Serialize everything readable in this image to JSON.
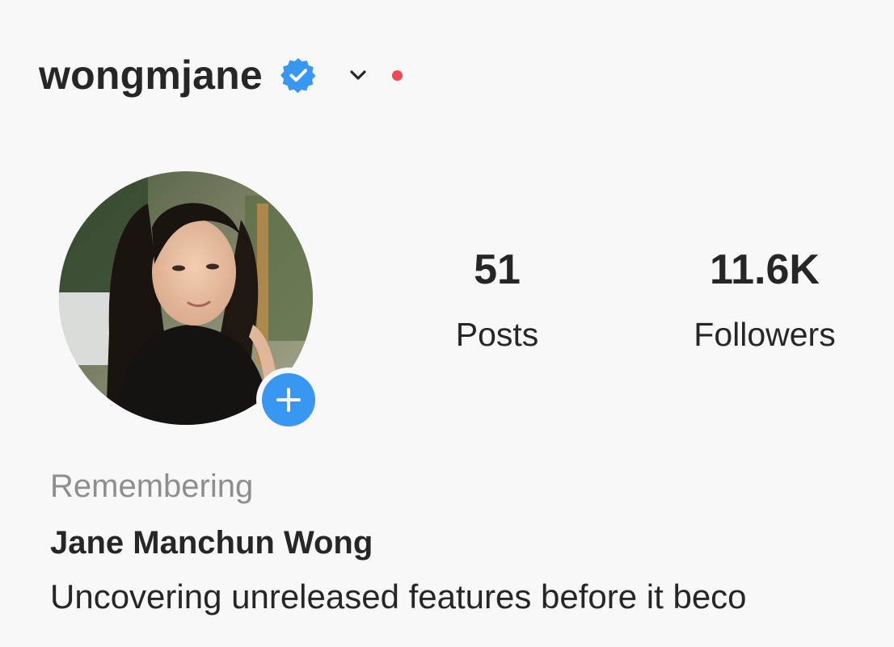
{
  "profile": {
    "username": "wongmjane",
    "verified": true,
    "has_notification": true,
    "accent_color": "#3897f0",
    "notification_color": "#ed4956"
  },
  "stats": {
    "posts_count": "51",
    "posts_label": "Posts",
    "followers_count": "11.6K",
    "followers_label": "Followers"
  },
  "bio": {
    "memorial_label": "Remembering",
    "full_name": "Jane Manchun Wong",
    "description": "Uncovering unreleased features before it beco"
  },
  "icons": {
    "verified": "verified-badge-icon",
    "switch_account": "chevron-down-icon",
    "add_story": "plus-icon"
  }
}
